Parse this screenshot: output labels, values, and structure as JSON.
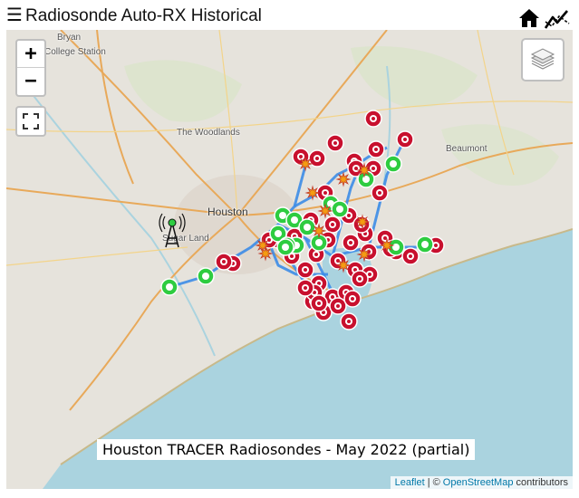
{
  "header": {
    "menu_glyph": "☰",
    "title": "Radiosonde Auto-RX Historical",
    "home_icon": "home-icon",
    "chart_icon": "line-chart-icon"
  },
  "map": {
    "city_labels": [
      {
        "text": "Bryan",
        "big": false
      },
      {
        "text": "College Station",
        "big": false
      },
      {
        "text": "The Woodlands",
        "big": false
      },
      {
        "text": "Houston",
        "big": true
      },
      {
        "text": "Sugar Land",
        "big": false
      },
      {
        "text": "Beaumont",
        "big": false
      }
    ],
    "caption": "Houston TRACER Radiosondes - May 2022 (partial)",
    "colors": {
      "land": "#e6e3dc",
      "water": "#aad3df",
      "track": "#3c8ce7",
      "landing_marker": "#c8102e",
      "launch_marker": "#2ecc40"
    }
  },
  "controls": {
    "zoom_in": "+",
    "zoom_out": "−",
    "fullscreen_icon": "fullscreen-icon",
    "layers_icon": "layers-icon"
  },
  "attribution": {
    "leaflet": "Leaflet",
    "separator": "| ©",
    "osm": "OpenStreetMap",
    "suffix": "contributors"
  }
}
